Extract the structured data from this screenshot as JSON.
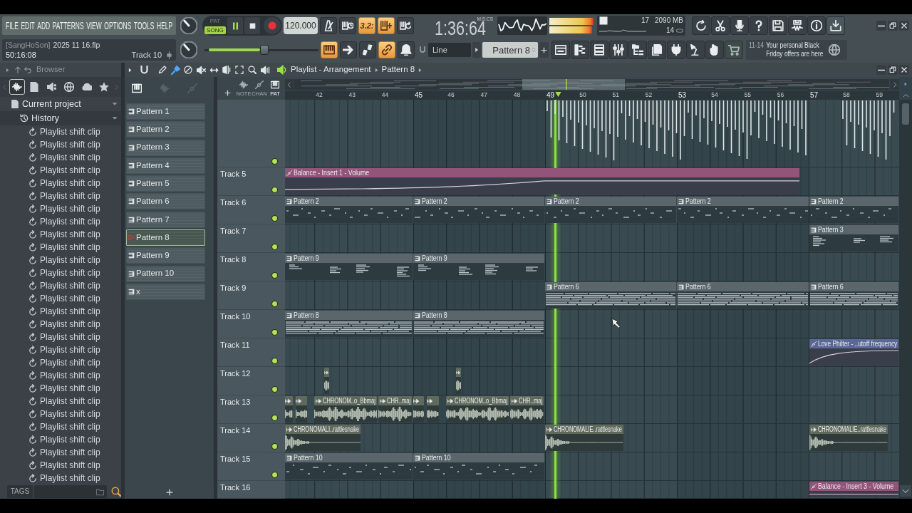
{
  "menu_bar": {
    "items": [
      "FILE",
      "EDIT",
      "ADD",
      "PATTERNS",
      "VIEW",
      "OPTIONS",
      "TOOLS",
      "HELP"
    ]
  },
  "transport": {
    "modes": [
      {
        "label": "PAT",
        "selected": false
      },
      {
        "label": "SONG",
        "selected": true
      }
    ],
    "playing": true,
    "tempo": "120.000"
  },
  "record_toggles": [
    {
      "kind": "metronome",
      "on": false
    },
    {
      "kind": "wait",
      "on": false
    },
    {
      "kind": "countdown",
      "label": "3.2:",
      "on": true
    },
    {
      "kind": "blend",
      "on": true
    },
    {
      "kind": "loop",
      "on": false
    }
  ],
  "song_time": {
    "value": "1:36:64",
    "unit": "M:S:CS"
  },
  "monitor": {
    "readings": [
      "17",
      "2090 MB",
      "14"
    ]
  },
  "hint_bar": {
    "owner": "[SangHoSon]",
    "file": "2025 11 16.flp",
    "time": "50:16:08",
    "target": "Track 10"
  },
  "main_slider": {
    "level": 0.53
  },
  "mode_toggles": [
    {
      "kind": "keyboard",
      "on": true
    },
    {
      "kind": "arrow",
      "on": false
    },
    {
      "kind": "steps",
      "on": false
    },
    {
      "kind": "link",
      "on": true
    },
    {
      "kind": "bell",
      "on": false
    }
  ],
  "snap": {
    "value": "Line"
  },
  "pattern_selector": {
    "value": "Pattern 8"
  },
  "news": {
    "date": "11-14",
    "text": "Your personal Black Friday offers are here"
  },
  "browser": {
    "title": "Browser",
    "tabs": [
      {
        "kind": "audio",
        "selected": true
      },
      {
        "kind": "files",
        "selected": false
      },
      {
        "kind": "plugins",
        "selected": false
      },
      {
        "kind": "web",
        "selected": false
      },
      {
        "kind": "cloud",
        "selected": false
      },
      {
        "kind": "starred",
        "selected": false
      }
    ],
    "tree": [
      {
        "label": "Current project",
        "kind": "project",
        "expanded": true,
        "children": [
          {
            "label": "History",
            "kind": "history",
            "expanded": true,
            "children": [
              {
                "label": "Playlist shift clip",
                "kind": "undo"
              },
              {
                "label": "Playlist shift clip",
                "kind": "undo"
              },
              {
                "label": "Playlist shift clip",
                "kind": "undo"
              },
              {
                "label": "Playlist shift clip",
                "kind": "undo"
              },
              {
                "label": "Playlist shift clip",
                "kind": "undo"
              },
              {
                "label": "Playlist shift clip",
                "kind": "undo"
              },
              {
                "label": "Playlist shift clip",
                "kind": "undo"
              },
              {
                "label": "Playlist shift clip",
                "kind": "undo"
              },
              {
                "label": "Playlist shift clip",
                "kind": "undo"
              },
              {
                "label": "Playlist shift clip",
                "kind": "undo"
              },
              {
                "label": "Playlist shift clip",
                "kind": "undo"
              },
              {
                "label": "Playlist shift clip",
                "kind": "undo"
              },
              {
                "label": "Playlist shift clip",
                "kind": "undo"
              },
              {
                "label": "Playlist shift clip",
                "kind": "undo"
              },
              {
                "label": "Playlist shift clip",
                "kind": "undo"
              },
              {
                "label": "Playlist shift clip",
                "kind": "undo"
              },
              {
                "label": "Playlist shift clip",
                "kind": "undo"
              },
              {
                "label": "Playlist shift clip",
                "kind": "undo"
              },
              {
                "label": "Playlist shift clip",
                "kind": "undo"
              },
              {
                "label": "Playlist shift clip",
                "kind": "undo"
              },
              {
                "label": "Playlist shift clip",
                "kind": "undo"
              },
              {
                "label": "Playlist shift clip",
                "kind": "undo"
              },
              {
                "label": "Playlist shift clip",
                "kind": "undo"
              },
              {
                "label": "Playlist shift clip",
                "kind": "undo"
              },
              {
                "label": "Playlist shift clip",
                "kind": "undo"
              },
              {
                "label": "Playlist shift clip",
                "kind": "undo"
              },
              {
                "label": "Playlist shift clip",
                "kind": "undo"
              },
              {
                "label": "Playlist shift clip",
                "kind": "undo"
              }
            ]
          }
        ]
      }
    ],
    "tags": {
      "label": "TAGS"
    }
  },
  "picker": {
    "tabs": [
      {
        "kind": "patterns",
        "selected": true
      },
      {
        "kind": "audio",
        "selected": false
      },
      {
        "kind": "automation",
        "selected": false
      }
    ],
    "items": [
      {
        "label": "Pattern 1",
        "selected": false
      },
      {
        "label": "Pattern 2",
        "selected": false
      },
      {
        "label": "Pattern 3",
        "selected": false
      },
      {
        "label": "Pattern 4",
        "selected": false
      },
      {
        "label": "Pattern 5",
        "selected": false
      },
      {
        "label": "Pattern 6",
        "selected": false
      },
      {
        "label": "Pattern 7",
        "selected": false
      },
      {
        "label": "Pattern 8",
        "selected": true
      },
      {
        "label": "Pattern 9",
        "selected": false
      },
      {
        "label": "Pattern 10",
        "selected": false
      },
      {
        "label": "x",
        "selected": false
      }
    ]
  },
  "playlist": {
    "title": "Playlist - Arrangement",
    "pattern": "Pattern 8",
    "tools": [
      {
        "kind": "options",
        "selected": false
      },
      {
        "kind": "magnet",
        "selected": false
      },
      {
        "kind": "draw",
        "selected": false
      },
      {
        "kind": "paint",
        "selected": true
      },
      {
        "kind": "delete",
        "selected": false
      },
      {
        "kind": "mute",
        "selected": false
      },
      {
        "kind": "slip",
        "selected": false
      },
      {
        "kind": "slice",
        "selected": false
      },
      {
        "kind": "select",
        "selected": false
      },
      {
        "kind": "zoom",
        "selected": false
      },
      {
        "kind": "playback",
        "selected": false
      }
    ],
    "filters": [
      {
        "kind": "audio",
        "label": "NOTE",
        "selected": false
      },
      {
        "kind": "automation",
        "label": "CHAN",
        "selected": false
      },
      {
        "kind": "pattern",
        "label": "PAT",
        "selected": true
      }
    ],
    "bars": [
      "42",
      "43",
      "44",
      "45",
      "46",
      "47",
      "48",
      "49",
      "50",
      "51",
      "52",
      "53",
      "54",
      "55",
      "56",
      "57",
      "58",
      "59"
    ],
    "tracks": [
      {
        "enabled": true,
        "clips": [
          {
            "kind": "waveform"
          },
          {
            "kind": "waveform"
          }
        ]
      },
      {
        "label": "Track 5",
        "enabled": true,
        "clips": [
          {
            "kind": "automation",
            "label": "Balance - Insert 1 - Volume",
            "color": "#93547a"
          }
        ]
      },
      {
        "label": "Track 6",
        "enabled": true,
        "clips": [
          {
            "kind": "pattern",
            "label": "Pattern 2"
          },
          {
            "kind": "pattern",
            "label": "Pattern 2"
          },
          {
            "kind": "pattern",
            "label": "Pattern 2"
          },
          {
            "kind": "pattern",
            "label": "Pattern 2"
          },
          {
            "kind": "pattern",
            "label": "Pattern 2"
          }
        ]
      },
      {
        "label": "Track 7",
        "enabled": true,
        "clips": [
          {
            "kind": "pattern",
            "label": "Pattern 3"
          }
        ]
      },
      {
        "label": "Track 8",
        "enabled": true,
        "clips": [
          {
            "kind": "pattern",
            "label": "Pattern 9"
          },
          {
            "kind": "pattern",
            "label": "Pattern 9"
          }
        ]
      },
      {
        "label": "Track 9",
        "enabled": true,
        "clips": [
          {
            "kind": "pattern",
            "label": "Pattern 6"
          },
          {
            "kind": "pattern",
            "label": "Pattern 6"
          },
          {
            "kind": "pattern",
            "label": "Pattern 6"
          }
        ]
      },
      {
        "label": "Track 10",
        "enabled": true,
        "clips": [
          {
            "kind": "pattern",
            "label": "Pattern 8"
          },
          {
            "kind": "pattern",
            "label": "Pattern 8"
          }
        ]
      },
      {
        "label": "Track 11",
        "enabled": true,
        "clips": [
          {
            "kind": "automation",
            "label": "Love Philter - ..utoff frequency",
            "color": "#5b6897"
          }
        ]
      },
      {
        "label": "Track 12",
        "enabled": true,
        "clips": [
          {
            "kind": "audio"
          },
          {
            "kind": "audio"
          }
        ]
      },
      {
        "label": "Track 13",
        "enabled": true,
        "clips": [
          {
            "kind": "audio"
          },
          {
            "kind": "audio"
          },
          {
            "kind": "audio",
            "label": "CHRONOM..o_Bbmaj"
          },
          {
            "kind": "audio",
            "label": "CHR..maj"
          },
          {
            "kind": "audio"
          },
          {
            "kind": "audio"
          },
          {
            "kind": "audio",
            "label": "CHRONOM..o_Bbmaj"
          },
          {
            "kind": "audio",
            "label": "CHR..maj"
          }
        ]
      },
      {
        "label": "Track 14",
        "enabled": true,
        "clips": [
          {
            "kind": "audio",
            "label": "CHRONOMALI..rattlesnake"
          },
          {
            "kind": "audio",
            "label": "CHRONOMALIE..rattlesnake"
          },
          {
            "kind": "audio",
            "label": "CHRONOMALIE..rattlesnake"
          }
        ]
      },
      {
        "label": "Track 15",
        "enabled": true,
        "clips": [
          {
            "kind": "pattern",
            "label": "Pattern 10"
          },
          {
            "kind": "pattern",
            "label": "Pattern 10"
          }
        ]
      },
      {
        "label": "Track 16",
        "clips": [
          {
            "kind": "automation",
            "label": "Balance - Insert 3 - Volume",
            "color": "#93547a"
          }
        ]
      }
    ]
  }
}
